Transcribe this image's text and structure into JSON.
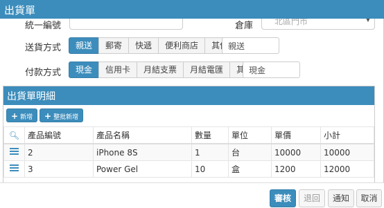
{
  "dialog": {
    "title": "出貨單"
  },
  "scrolled_row": {
    "tax_id_label": "統一編號",
    "warehouse_label": "倉庫",
    "warehouse_value": "北區門市"
  },
  "shipping": {
    "label": "送貨方式",
    "options": [
      "親送",
      "郵寄",
      "快遞",
      "便利商店",
      "其他"
    ],
    "selected": "親送",
    "input_value": "親送"
  },
  "payment": {
    "label": "付款方式",
    "options": [
      "現金",
      "信用卡",
      "月結支票",
      "月結電匯",
      "其他"
    ],
    "selected": "現金",
    "input_value": "現金"
  },
  "details": {
    "title": "出貨單明細",
    "add_label": "新增",
    "batch_add_label": "整批新增",
    "columns": [
      "產品編號",
      "產品名稱",
      "數量",
      "單位",
      "單價",
      "小計"
    ],
    "rows": [
      {
        "product_no": "2",
        "product_name": "iPhone 8S",
        "qty": "1",
        "unit": "台",
        "price": "10000",
        "subtotal": "10000"
      },
      {
        "product_no": "3",
        "product_name": "Power Gel",
        "qty": "10",
        "unit": "盒",
        "price": "1200",
        "subtotal": "12000"
      }
    ]
  },
  "footer": {
    "review_label": "審核",
    "return_label": "退回",
    "notify_label": "通知",
    "cancel_label": "取消"
  },
  "colors": {
    "primary": "#3c8dbc"
  },
  "icons": {
    "add": "plus-icon",
    "search": "search-icon",
    "row": "list-icon",
    "dropdown": "caret-down-icon"
  }
}
